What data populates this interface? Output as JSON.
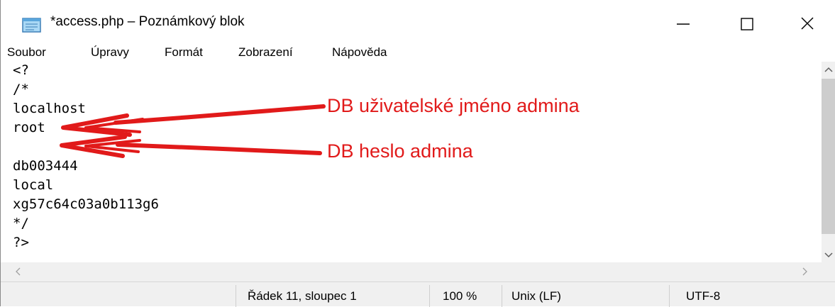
{
  "window": {
    "title": "*access.php – Poznámkový blok",
    "icon": "notepad-icon",
    "controls": [
      "minimize-icon",
      "maximize-icon",
      "close-icon"
    ]
  },
  "menu": {
    "items": [
      {
        "label": "Soubor"
      },
      {
        "label": "Úpravy"
      },
      {
        "label": "Formát"
      },
      {
        "label": "Zobrazení"
      },
      {
        "label": "Nápověda"
      }
    ]
  },
  "editor": {
    "lines": [
      "<?",
      "/*",
      "localhost",
      "root",
      "",
      "db003444",
      "local",
      "xg57c64c03a0b113g6",
      "*/",
      "?>"
    ]
  },
  "annotations": {
    "label1": "DB uživatelské jméno admina",
    "label2": "DB heslo admina",
    "color": "#e11a1a"
  },
  "status": {
    "position": "Řádek 11, sloupec 1",
    "zoom": "100 %",
    "line_ending": "Unix (LF)",
    "encoding": "UTF-8"
  }
}
